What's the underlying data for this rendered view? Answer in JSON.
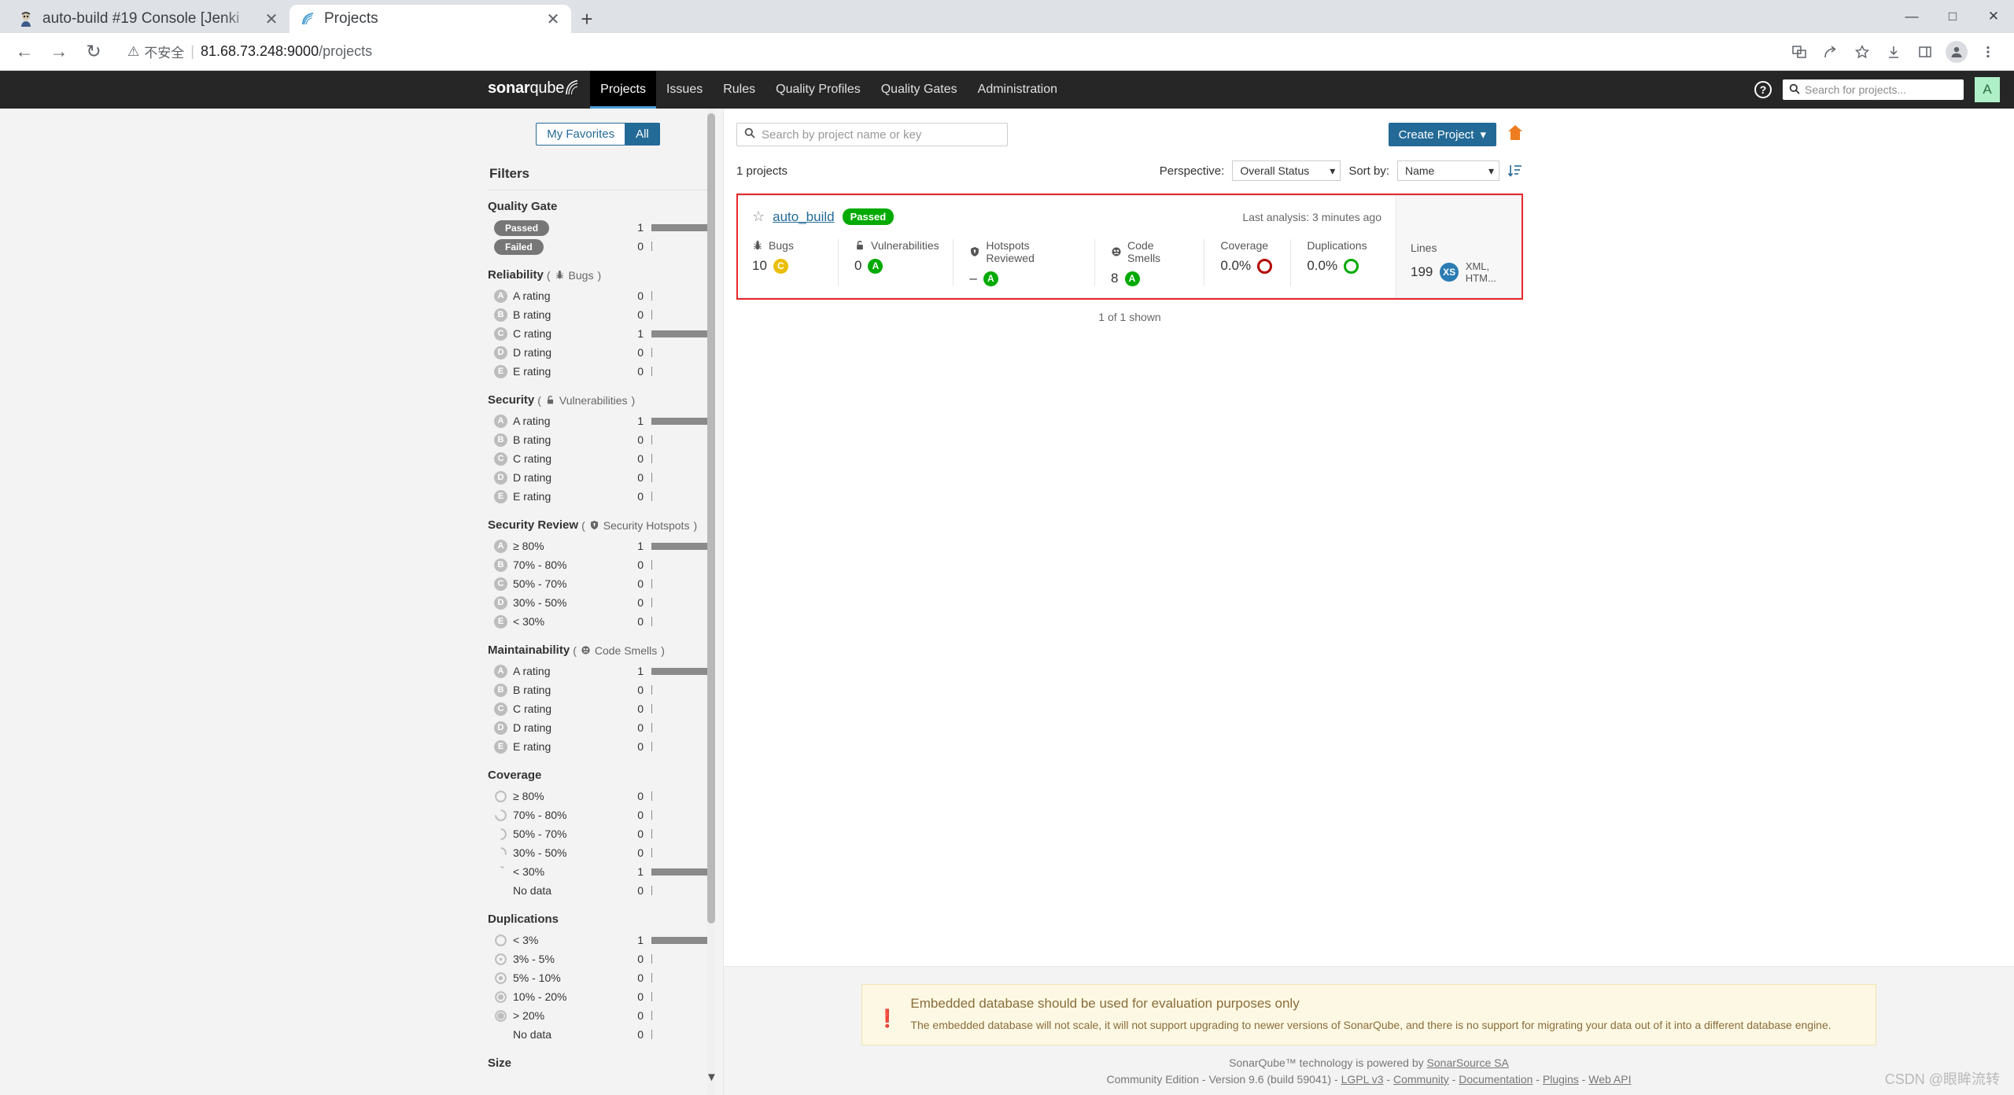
{
  "browser": {
    "tabs": [
      {
        "title": "auto-build #19 Console [Jenki",
        "favicon": "jenkins-icon",
        "active": false
      },
      {
        "title": "Projects",
        "favicon": "sonarqube-icon",
        "active": true
      }
    ],
    "newtab_label": "+",
    "window_controls": {
      "minimize": "—",
      "maximize": "□",
      "close": "✕"
    },
    "toolbar": {
      "back": "←",
      "forward": "→",
      "reload": "↻",
      "security_label": "不安全",
      "separator": "|",
      "url_host": "81.68.73.248:9000",
      "url_path": "/projects"
    },
    "toolbar_icons": [
      "translate-icon",
      "share-icon",
      "bookmark-star-icon",
      "download-icon",
      "sidepanel-icon",
      "profile-icon",
      "menu-kebab-icon"
    ]
  },
  "sonarqube": {
    "logo": {
      "bold": "sonar",
      "light": "qube"
    },
    "nav_items": [
      {
        "label": "Projects",
        "active": true
      },
      {
        "label": "Issues",
        "active": false
      },
      {
        "label": "Rules",
        "active": false
      },
      {
        "label": "Quality Profiles",
        "active": false
      },
      {
        "label": "Quality Gates",
        "active": false
      },
      {
        "label": "Administration",
        "active": false
      }
    ],
    "help_label": "?",
    "global_search_placeholder": "Search for projects...",
    "avatar_initial": "A"
  },
  "sidebar": {
    "favorites_toggle": [
      {
        "label": "My Favorites",
        "active": false
      },
      {
        "label": "All",
        "active": true
      }
    ],
    "filters_title": "Filters",
    "facets": [
      {
        "title": "Quality Gate",
        "sub": "",
        "sub_icon": "",
        "style": "pill",
        "rows": [
          {
            "label": "Passed",
            "count": "1",
            "bar": 72
          },
          {
            "label": "Failed",
            "count": "0",
            "bar": 0
          }
        ]
      },
      {
        "title": "Reliability",
        "sub": "Bugs",
        "sub_icon": "bug-icon",
        "style": "rating",
        "rows": [
          {
            "icon": "A",
            "label": "A rating",
            "count": "0",
            "bar": 0
          },
          {
            "icon": "B",
            "label": "B rating",
            "count": "0",
            "bar": 0
          },
          {
            "icon": "C",
            "label": "C rating",
            "count": "1",
            "bar": 72
          },
          {
            "icon": "D",
            "label": "D rating",
            "count": "0",
            "bar": 0
          },
          {
            "icon": "E",
            "label": "E rating",
            "count": "0",
            "bar": 0
          }
        ]
      },
      {
        "title": "Security",
        "sub": "Vulnerabilities",
        "sub_icon": "lock-icon",
        "style": "rating",
        "rows": [
          {
            "icon": "A",
            "label": "A rating",
            "count": "1",
            "bar": 72
          },
          {
            "icon": "B",
            "label": "B rating",
            "count": "0",
            "bar": 0
          },
          {
            "icon": "C",
            "label": "C rating",
            "count": "0",
            "bar": 0
          },
          {
            "icon": "D",
            "label": "D rating",
            "count": "0",
            "bar": 0
          },
          {
            "icon": "E",
            "label": "E rating",
            "count": "0",
            "bar": 0
          }
        ]
      },
      {
        "title": "Security Review",
        "sub": "Security Hotspots",
        "sub_icon": "shield-icon",
        "style": "rating",
        "rows": [
          {
            "icon": "A",
            "label": "≥ 80%",
            "count": "1",
            "bar": 72
          },
          {
            "icon": "B",
            "label": "70% - 80%",
            "count": "0",
            "bar": 0
          },
          {
            "icon": "C",
            "label": "50% - 70%",
            "count": "0",
            "bar": 0
          },
          {
            "icon": "D",
            "label": "30% - 50%",
            "count": "0",
            "bar": 0
          },
          {
            "icon": "E",
            "label": "< 30%",
            "count": "0",
            "bar": 0
          }
        ]
      },
      {
        "title": "Maintainability",
        "sub": "Code Smells",
        "sub_icon": "code-smell-icon",
        "style": "rating",
        "rows": [
          {
            "icon": "A",
            "label": "A rating",
            "count": "1",
            "bar": 72
          },
          {
            "icon": "B",
            "label": "B rating",
            "count": "0",
            "bar": 0
          },
          {
            "icon": "C",
            "label": "C rating",
            "count": "0",
            "bar": 0
          },
          {
            "icon": "D",
            "label": "D rating",
            "count": "0",
            "bar": 0
          },
          {
            "icon": "E",
            "label": "E rating",
            "count": "0",
            "bar": 0
          }
        ]
      },
      {
        "title": "Coverage",
        "sub": "",
        "sub_icon": "",
        "style": "donut",
        "rows": [
          {
            "fill": 0,
            "label": "≥ 80%",
            "count": "0",
            "bar": 0
          },
          {
            "fill": 25,
            "label": "70% - 80%",
            "count": "0",
            "bar": 0
          },
          {
            "fill": 50,
            "label": "50% - 70%",
            "count": "0",
            "bar": 0
          },
          {
            "fill": 70,
            "label": "30% - 50%",
            "count": "0",
            "bar": 0
          },
          {
            "fill": 90,
            "label": "< 30%",
            "count": "1",
            "bar": 72
          },
          {
            "fill": -1,
            "label": "No data",
            "count": "0",
            "bar": 0
          }
        ]
      },
      {
        "title": "Duplications",
        "sub": "",
        "sub_icon": "",
        "style": "dupdonut",
        "rows": [
          {
            "fill": 0,
            "label": "< 3%",
            "count": "1",
            "bar": 72
          },
          {
            "fill": 12,
            "label": "3% - 5%",
            "count": "0",
            "bar": 0
          },
          {
            "fill": 28,
            "label": "5% - 10%",
            "count": "0",
            "bar": 0
          },
          {
            "fill": 42,
            "label": "10% - 20%",
            "count": "0",
            "bar": 0
          },
          {
            "fill": 55,
            "label": "> 20%",
            "count": "0",
            "bar": 0
          },
          {
            "fill": -1,
            "label": "No data",
            "count": "0",
            "bar": 0
          }
        ]
      },
      {
        "title": "Size",
        "sub": "",
        "sub_icon": "",
        "style": "rating",
        "rows": []
      }
    ]
  },
  "main": {
    "search_placeholder": "Search by project name or key",
    "create_project_label": "Create Project",
    "create_project_caret": "▾",
    "project_count": "1 projects",
    "perspective_label": "Perspective:",
    "perspective_value": "Overall Status",
    "sort_label": "Sort by:",
    "sort_value": "Name",
    "shown_text": "1 of 1 shown",
    "project": {
      "name": "auto_build",
      "quality_gate": "Passed",
      "last_analysis": "Last analysis: 3 minutes ago",
      "metrics": [
        {
          "icon": "bug-icon",
          "label": "Bugs",
          "value": "10",
          "rating": "C",
          "rating_color": "#eabe06"
        },
        {
          "icon": "lock-icon",
          "label": "Vulnerabilities",
          "value": "0",
          "rating": "A",
          "rating_color": "#00aa00"
        },
        {
          "icon": "shield-icon",
          "label": "Hotspots Reviewed",
          "value": "–",
          "rating": "A",
          "rating_color": "#00aa00"
        },
        {
          "icon": "code-smell-icon",
          "label": "Code Smells",
          "value": "8",
          "rating": "A",
          "rating_color": "#00aa00"
        },
        {
          "icon": "",
          "label": "Coverage",
          "value": "0.0%",
          "ring_color": "#b30000"
        },
        {
          "icon": "",
          "label": "Duplications",
          "value": "0.0%",
          "ring_color": "#00aa00"
        }
      ],
      "lines_label": "Lines",
      "lines_value": "199",
      "size_badge": "XS",
      "languages": "XML, HTM..."
    }
  },
  "alert": {
    "icon": "warning-icon",
    "title": "Embedded database should be used for evaluation purposes only",
    "text": "The embedded database will not scale, it will not support upgrading to newer versions of SonarQube, and there is no support for migrating your data out of it into a different database engine."
  },
  "footer": {
    "line1_prefix": "SonarQube™ technology is powered by ",
    "line1_link": "SonarSource SA",
    "line2_prefix": "Community Edition - Version 9.6 (build 59041) - ",
    "links": [
      "LGPL v3",
      "Community",
      "Documentation",
      "Plugins",
      "Web API"
    ],
    "separator": " - "
  },
  "watermark": "CSDN @眼眸流转",
  "colors": {
    "brand_blue": "#236a97",
    "nav_dark": "#262626",
    "accent_underline": "#4b9fd5",
    "pass_green": "#00aa00",
    "rating_c_yellow": "#eabe06",
    "highlight_red": "#e8272c"
  }
}
